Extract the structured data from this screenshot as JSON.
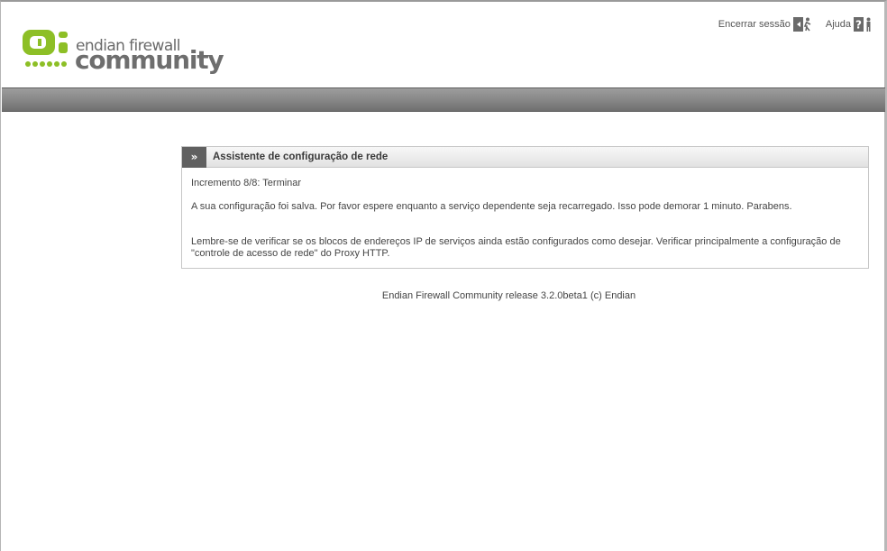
{
  "header": {
    "logo": {
      "line1": "endian firewall",
      "line2": "community",
      "accent_color": "#8dbf26",
      "icon": "endian-logo-icon"
    },
    "logout_label": "Encerrar sessão",
    "logout_icon": "logout-exit-icon",
    "help_label": "Ajuda",
    "help_icon": "help-question-icon"
  },
  "panel": {
    "toggle_glyph": "»",
    "title": "Assistente de configuração de rede",
    "step": "Incremento 8/8: Terminar",
    "saved_message": "A sua configuração foi salva. Por favor espere enquanto a serviço dependente seja recarregado. Isso pode demorar 1 minuto. Parabens.",
    "reminder_message": "Lembre-se de verificar se os blocos de endereços IP de serviços ainda estão configurados como desejar. Verificar principalmente a configuração de \"controle de acesso de rede\" do Proxy HTTP."
  },
  "footer": {
    "text": "Endian Firewall Community release 3.2.0beta1 (c) Endian"
  }
}
